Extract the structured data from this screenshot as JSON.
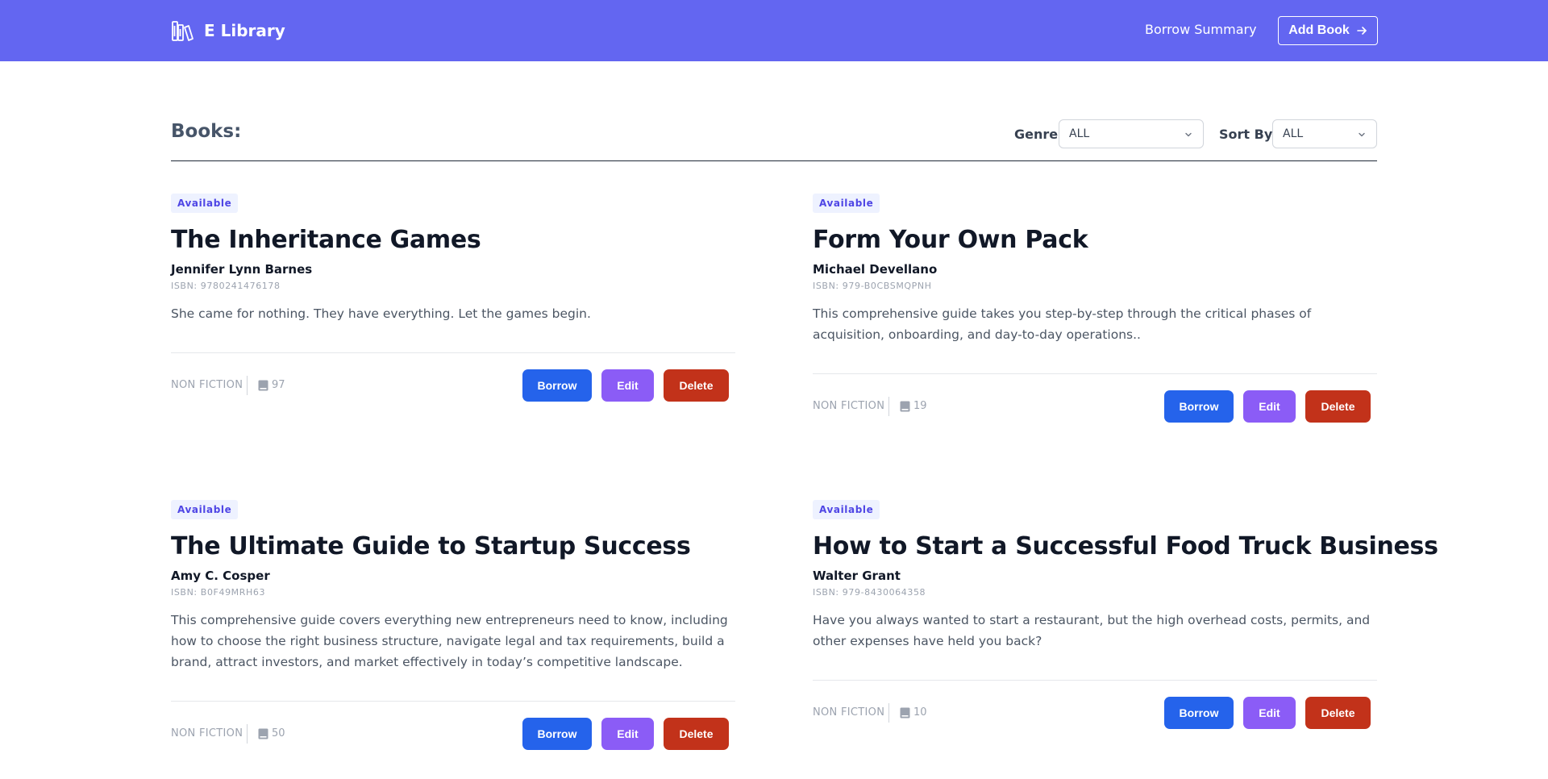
{
  "header": {
    "brand": "E Library",
    "borrow_summary": "Borrow Summary",
    "add_book": "Add Book",
    "bg_color": "#6366f1"
  },
  "toolbar": {
    "title": "Books:",
    "genre_label": "Genre:",
    "genre_value": "ALL",
    "sort_label": "Sort By:",
    "sort_value": "ALL"
  },
  "books": [
    {
      "status": "Available",
      "title": "The Inheritance Games",
      "author": "Jennifer Lynn Barnes",
      "isbn": "ISBN: 9780241476178",
      "description": "She came for nothing. They have everything. Let the games begin.",
      "genre": "NON FICTION",
      "copies": "97",
      "borrow": "Borrow",
      "edit": "Edit",
      "delete": "Delete"
    },
    {
      "status": "Available",
      "title": "Form Your Own Pack",
      "author": "Michael Devellano",
      "isbn": "ISBN: 979-B0CBSMQPNH",
      "description": "This comprehensive guide takes you step-by-step through the critical phases of acquisition, onboarding, and day-to-day operations..",
      "genre": "NON FICTION",
      "copies": "19",
      "borrow": "Borrow",
      "edit": "Edit",
      "delete": "Delete"
    },
    {
      "status": "Available",
      "title": "The Ultimate Guide to Startup Success",
      "author": "Amy C. Cosper",
      "isbn": "ISBN: B0F49MRH63",
      "description": "This comprehensive guide covers everything new entrepreneurs need to know, including how to choose the right business structure, navigate legal and tax requirements, build a brand, attract investors, and market effectively in today’s competitive landscape.",
      "genre": "NON FICTION",
      "copies": "50",
      "borrow": "Borrow",
      "edit": "Edit",
      "delete": "Delete"
    },
    {
      "status": "Available",
      "title": "How to Start a Successful Food Truck Business",
      "author": "Walter Grant",
      "isbn": "ISBN: 979-8430064358",
      "description": "Have you always wanted to start a restaurant, but the high overhead costs, permits, and other expenses have held you back?",
      "genre": "NON FICTION",
      "copies": "10",
      "borrow": "Borrow",
      "edit": "Edit",
      "delete": "Delete"
    }
  ],
  "icons": {
    "brand": "books-icon",
    "add_book": "arrow-right-icon",
    "select": "chevron-down-icon",
    "copies": "book-icon"
  },
  "colors": {
    "borrow": "#2563eb",
    "edit": "#8b5cf6",
    "delete": "#c2321a",
    "badge_text": "#4f46e5",
    "badge_bg": "#eef2ff"
  }
}
